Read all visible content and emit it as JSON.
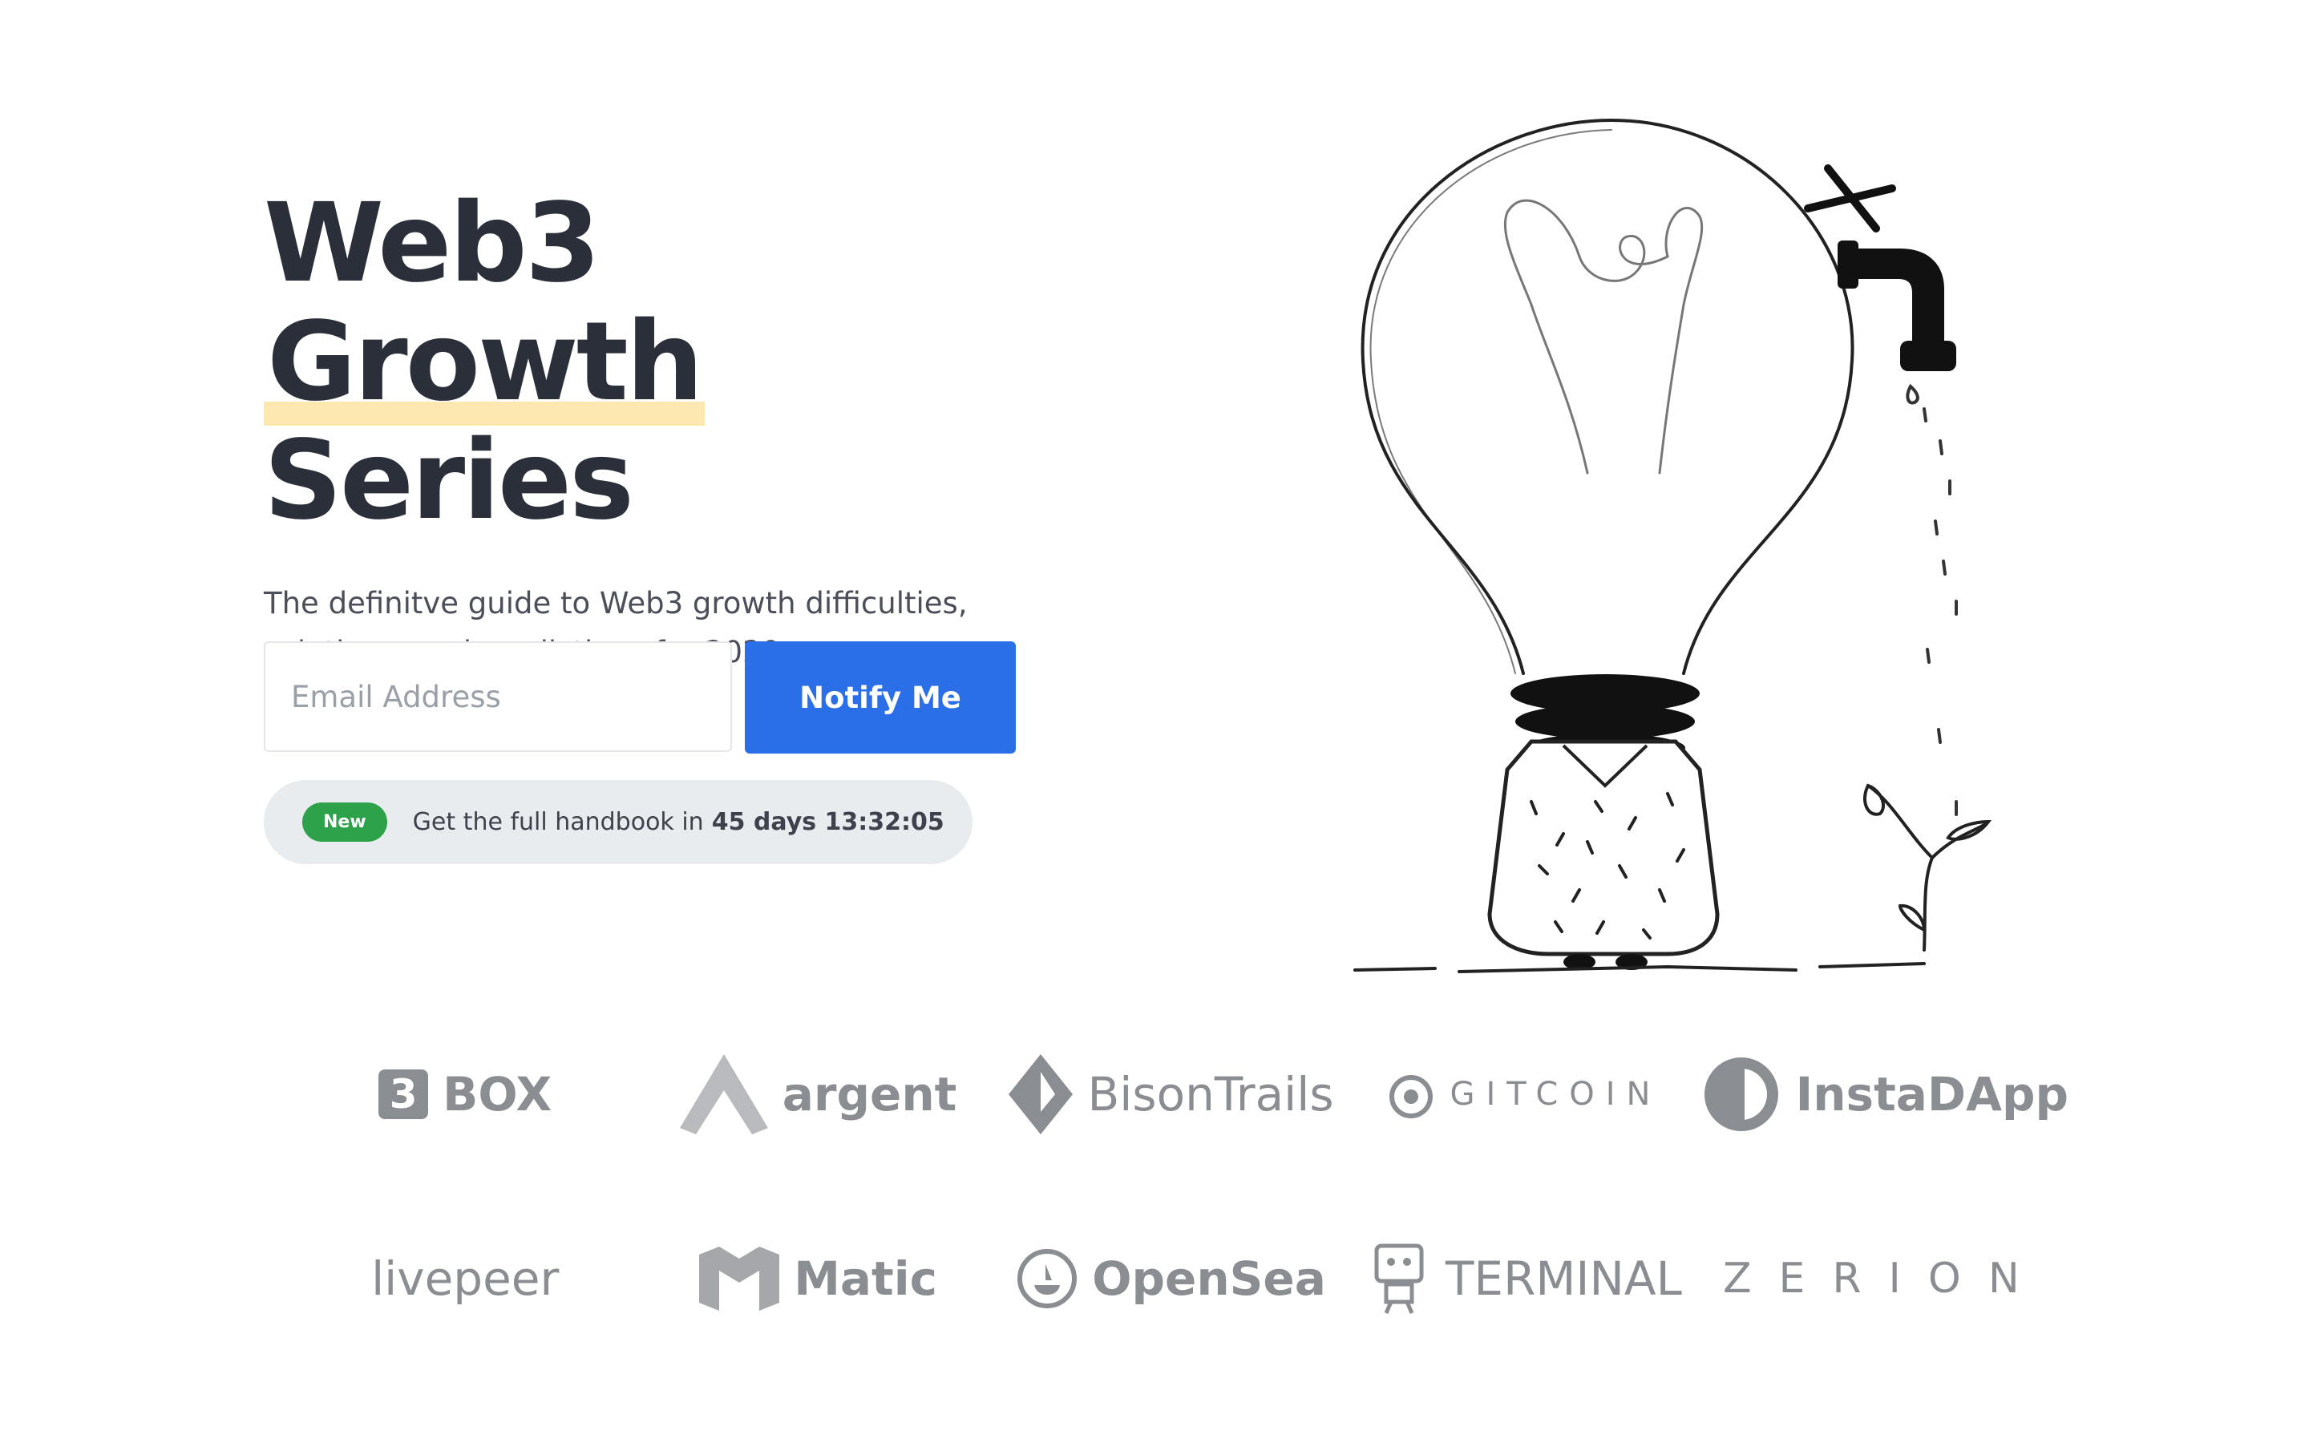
{
  "hero": {
    "title_line1": "Web3",
    "title_highlight": "Growth",
    "title_line2": "Series",
    "subtitle": "The definitve guide to Web3 growth difficulties, solutions, and predictions for 2020."
  },
  "signup": {
    "email_placeholder": "Email Address",
    "email_value": "",
    "button_label": "Notify Me"
  },
  "banner": {
    "badge": "New",
    "text": "Get the full handbook in",
    "countdown": "45 days 13:32:05"
  },
  "colors": {
    "accent_blue": "#2b6fe8",
    "highlight_yellow": "#fde8b0",
    "badge_green": "#2da24a",
    "title_dark": "#2a2f3a",
    "logo_gray": "#8a8d91"
  },
  "logos": {
    "row1": [
      {
        "icon": "3box-icon",
        "mark": "3",
        "name": "BOX"
      },
      {
        "icon": "argent-icon",
        "name": "argent"
      },
      {
        "icon": "bisontrails-icon",
        "name": "BisonTrails"
      },
      {
        "icon": "gitcoin-icon",
        "name": "GITCOIN"
      },
      {
        "icon": "instadapp-icon",
        "name": "InstaDApp"
      }
    ],
    "row2": [
      {
        "name": "livepeer"
      },
      {
        "icon": "matic-icon",
        "name": "Matic"
      },
      {
        "icon": "opensea-icon",
        "name": "OpenSea"
      },
      {
        "icon": "terminal-robot-icon",
        "name": "TERMINAL"
      },
      {
        "name": "ZERION"
      }
    ]
  }
}
